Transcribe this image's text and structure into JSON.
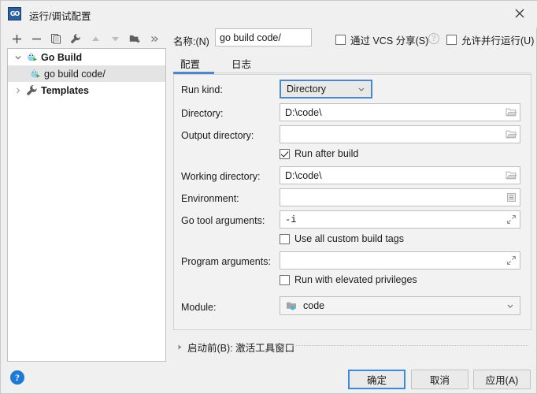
{
  "window": {
    "title": "运行/调试配置",
    "app_icon": "go-logo-icon",
    "close_label": "×"
  },
  "toolbar": {
    "buttons": [
      {
        "name": "add-button",
        "icon": "plus-icon",
        "label": "+"
      },
      {
        "name": "remove-button",
        "icon": "minus-icon",
        "label": "−"
      },
      {
        "name": "copy-button",
        "icon": "copy-icon",
        "label": "Copy"
      },
      {
        "name": "edit-templates-button",
        "icon": "wrench-icon",
        "label": "Edit Templates"
      },
      {
        "name": "move-up-button",
        "icon": "arrow-up-icon",
        "label": "Move Up"
      },
      {
        "name": "move-down-button",
        "icon": "arrow-down-icon",
        "label": "Move Down"
      },
      {
        "name": "new-folder-button",
        "icon": "folder-add-icon",
        "label": "New Folder"
      },
      {
        "name": "overflow-button",
        "icon": "chevron-double-right-icon",
        "label": "»"
      }
    ]
  },
  "name_row": {
    "label": "名称:(N)",
    "value": "go build code/",
    "placeholder": "",
    "share_vcs_checkbox": {
      "label": "通过 VCS 分享(S)",
      "checked": false
    },
    "share_vcs_help": "?",
    "allow_parallel_checkbox": {
      "label": "允许并行运行(U)",
      "checked": false
    }
  },
  "tree": {
    "nodes": [
      {
        "label": "Go Build",
        "icon": "go-run-icon",
        "expanded": true,
        "bold": true,
        "selected": false,
        "indent": 0
      },
      {
        "label": "go build code/",
        "icon": "go-run-icon",
        "expanded": null,
        "bold": false,
        "selected": true,
        "indent": 1
      },
      {
        "label": "Templates",
        "icon": "wrench-icon",
        "expanded": false,
        "bold": true,
        "selected": false,
        "indent": 0
      }
    ]
  },
  "tabs": [
    {
      "label": "配置",
      "selected": true
    },
    {
      "label": "日志",
      "selected": false
    }
  ],
  "form": {
    "run_kind": {
      "label": "Run kind:",
      "value": "Directory",
      "focused": true
    },
    "directory": {
      "label": "Directory:",
      "value": "D:\\code\\",
      "placeholder": "",
      "button_icon": "folder-icon"
    },
    "output_directory": {
      "label": "Output directory:",
      "value": "",
      "placeholder": "",
      "button_icon": "folder-icon"
    },
    "run_after_build": {
      "label": "Run after build",
      "checked": true
    },
    "working_directory": {
      "label": "Working directory:",
      "value": "D:\\code\\",
      "placeholder": "",
      "button_icon": "folder-icon"
    },
    "environment": {
      "label": "Environment:",
      "value": "",
      "placeholder": "",
      "button_icon": "list-edit-icon"
    },
    "go_tool_arguments": {
      "label": "Go tool arguments:",
      "value": "-i",
      "placeholder": "",
      "button_icon": "expand-diagonal-icon"
    },
    "use_all_custom_build_tags": {
      "label": "Use all custom build tags",
      "checked": false
    },
    "program_arguments": {
      "label": "Program arguments:",
      "value": "",
      "placeholder": "",
      "button_icon": "expand-diagonal-icon"
    },
    "run_with_elevated_privileges": {
      "label": "Run with elevated privileges",
      "checked": false
    },
    "module": {
      "label": "Module:",
      "value": "code",
      "icon": "module-icon"
    }
  },
  "before_launch": {
    "arrow": "triangle-right-icon",
    "text": "启动前(B): 激活工具窗口"
  },
  "footer": {
    "help": "?",
    "ok_button": "确定",
    "cancel_button": "取消",
    "apply_button": "应用(A)"
  },
  "colors": {
    "accent": "#4a88c7",
    "default_button_border": "#3a8adf",
    "help_blue": "#1e7ad4",
    "selection": "#e4e4e4",
    "panel_bg": "#f2f2f2"
  }
}
